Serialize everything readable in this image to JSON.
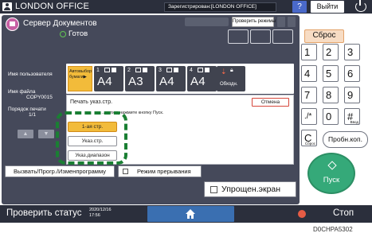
{
  "header": {
    "title": "LONDON OFFICE",
    "registration_status": "Зарегистрирован:[LONDON OFFICE]",
    "help_label": "?",
    "logout_label": "Выйти"
  },
  "app": {
    "title": "Сервер Документов",
    "status": "Готов",
    "check_modes_label": "Проверить режимы"
  },
  "left_info": {
    "user_name_label": "Имя пользователя",
    "file_name_label": "Имя файла",
    "file_name_value": "COPY0015",
    "print_order_label": "Порядок печати",
    "print_order_value": "1/1"
  },
  "trays": {
    "auto_select_label_1": "Автовыбор",
    "auto_select_label_2": "бумаги▶",
    "items": [
      {
        "number": "1",
        "size": "A4"
      },
      {
        "number": "2",
        "size": "A3"
      },
      {
        "number": "3",
        "size": "A4"
      },
      {
        "number": "4",
        "size": "A4"
      }
    ],
    "bypass_label": "Обходн."
  },
  "print_dialog": {
    "title": "Печать указ.стр.",
    "hint": "...чати и нажмите кнопку Пуск.",
    "cancel_label": "Отмена",
    "options": [
      "1-ая стр.",
      "Указ.стр.",
      "Указ.диапазон"
    ]
  },
  "bottom_actions": {
    "recall_program": "Вызвать/Прогр./Изменпрограмму",
    "interrupt_mode": "Режим прерывания",
    "simple_screen": "Упрощен.экран"
  },
  "keypad": {
    "reset_label": "Сброс",
    "keys": [
      "1",
      "2",
      "3",
      "4",
      "5",
      "6",
      "7",
      "8",
      "9",
      "./*",
      "0",
      "#"
    ],
    "hash_sub": "Ввод",
    "clear_label": "C",
    "clear_sub": "Сброс",
    "test_print_label": "Пробн.коп.",
    "start_label": "Пуск"
  },
  "statusbar": {
    "check_status": "Проверить статус",
    "date": "2020/12/16",
    "time": "17:56",
    "stop_label": "Стоп"
  },
  "image_code": "D0CHPA5302",
  "colors": {
    "panel_bg": "#45495a",
    "highlight_orange": "#f2bb3a",
    "dashed_highlight": "#1a7f33",
    "start_green": "#35a979",
    "home_blue": "#3a6fb1"
  }
}
